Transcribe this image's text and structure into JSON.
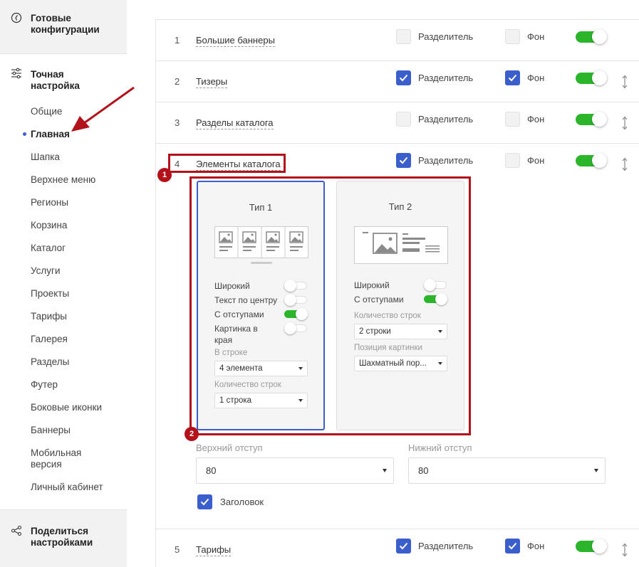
{
  "sidebar": {
    "top_block": {
      "label": "Готовые конфигурации",
      "line1": "Готовые",
      "line2": "конфигурации"
    },
    "section": {
      "label": "Точная настройка",
      "line1": "Точная",
      "line2": "настройка"
    },
    "items": [
      {
        "label": "Общие"
      },
      {
        "label": "Главная",
        "active": true
      },
      {
        "label": "Шапка"
      },
      {
        "label": "Верхнее меню"
      },
      {
        "label": "Регионы"
      },
      {
        "label": "Корзина"
      },
      {
        "label": "Каталог"
      },
      {
        "label": "Услуги"
      },
      {
        "label": "Проекты"
      },
      {
        "label": "Тарифы"
      },
      {
        "label": "Галерея"
      },
      {
        "label": "Разделы"
      },
      {
        "label": "Футер"
      },
      {
        "label": "Боковые иконки"
      },
      {
        "label": "Баннеры"
      },
      {
        "label": "Мобильная версия",
        "line1": "Мобильная",
        "line2": "версия"
      },
      {
        "label": "Личный кабинет"
      }
    ],
    "bottom_block": {
      "label": "Поделиться настройками",
      "line1": "Поделиться",
      "line2": "настройками"
    }
  },
  "rows": [
    {
      "num": "1",
      "label": "Большие баннеры",
      "divider_label": "Разделитель",
      "divider_checked": false,
      "bg_label": "Фон",
      "bg_checked": false,
      "enabled": true,
      "draggable": false
    },
    {
      "num": "2",
      "label": "Тизеры",
      "divider_label": "Разделитель",
      "divider_checked": true,
      "bg_label": "Фон",
      "bg_checked": true,
      "enabled": true,
      "draggable": true
    },
    {
      "num": "3",
      "label": "Разделы каталога",
      "divider_label": "Разделитель",
      "divider_checked": false,
      "bg_label": "Фон",
      "bg_checked": false,
      "enabled": true,
      "draggable": true
    },
    {
      "num": "4",
      "label": "Элементы каталога",
      "divider_label": "Разделитель",
      "divider_checked": true,
      "bg_label": "Фон",
      "bg_checked": false,
      "enabled": true,
      "draggable": true
    },
    {
      "num": "5",
      "label": "Тарифы",
      "divider_label": "Разделитель",
      "divider_checked": true,
      "bg_label": "Фон",
      "bg_checked": true,
      "enabled": true,
      "draggable": true
    }
  ],
  "types": [
    {
      "title": "Тип 1",
      "selected": true,
      "options": [
        {
          "label": "Широкий",
          "on": false
        },
        {
          "label": "Текст по центру",
          "on": false
        },
        {
          "label": "С отступами",
          "on": true
        },
        {
          "label": "Картинка в края",
          "line1": "Картинка в",
          "line2": "края",
          "on": false
        }
      ],
      "selects": [
        {
          "label": "В строке",
          "value": "4 элемента"
        },
        {
          "label": "Количество строк",
          "value": "1 строка"
        }
      ]
    },
    {
      "title": "Тип 2",
      "selected": false,
      "options": [
        {
          "label": "Широкий",
          "on": false
        },
        {
          "label": "С отступами",
          "on": true
        }
      ],
      "selects": [
        {
          "label": "Количество строк",
          "value": "2 строки"
        },
        {
          "label": "Позиция картинки",
          "value": "Шахматный пор..."
        }
      ]
    }
  ],
  "padding": {
    "top_label": "Верхний отступ",
    "top_value": "80",
    "bottom_label": "Нижний отступ",
    "bottom_value": "80"
  },
  "heading_checkbox": {
    "label": "Заголовок",
    "checked": true
  },
  "annotations": {
    "badge1": "1",
    "badge2": "2"
  },
  "colors": {
    "accent": "#3a5fcd",
    "toggle_on": "#2bb52b",
    "annotation": "#b3121b"
  }
}
